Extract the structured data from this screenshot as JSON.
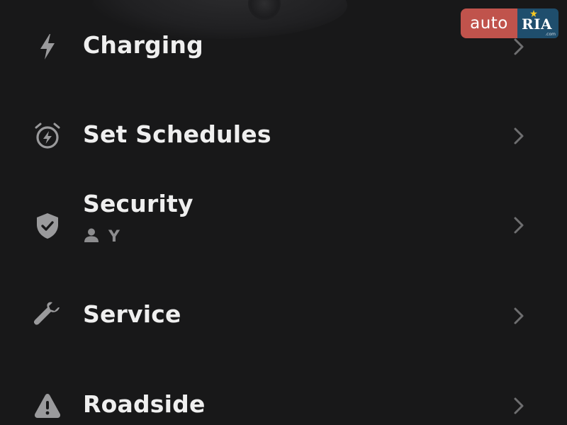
{
  "watermark": {
    "left_text": "auto",
    "right_text": "RIA",
    "small_text": ".com",
    "left_color": "#c0534c",
    "right_color": "#1f4e6d"
  },
  "menu": {
    "items": [
      {
        "label": "Charging",
        "icon": "lightning-bolt-icon"
      },
      {
        "label": "Set Schedules",
        "icon": "alarm-clock-icon"
      },
      {
        "label": "Security",
        "icon": "shield-check-icon",
        "subtitle": "Y",
        "subtitle_icon": "person-icon"
      },
      {
        "label": "Service",
        "icon": "wrench-icon"
      },
      {
        "label": "Roadside",
        "icon": "warning-triangle-icon"
      }
    ]
  },
  "colors": {
    "background": "#181819",
    "text": "#efefef",
    "icon": "#9a9a9c",
    "chevron": "#6e6e70",
    "subtitle": "#8c8c8e"
  }
}
